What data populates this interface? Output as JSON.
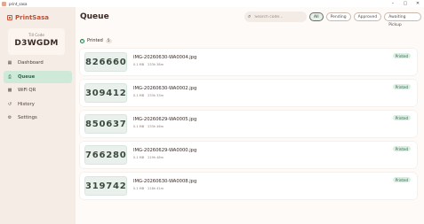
{
  "window": {
    "title": "print_sasa",
    "controls": [
      "–",
      "▢",
      "✕"
    ]
  },
  "sidebar": {
    "brand": "PrintSasa",
    "till_label": "Till Code",
    "till_code": "D3WGDM",
    "items": [
      {
        "label": "Dashboard",
        "icon": "dashboard-icon",
        "glyph": "▦",
        "active": false
      },
      {
        "label": "Queue",
        "icon": "printer-icon",
        "glyph": "⎙",
        "active": true
      },
      {
        "label": "WiFi QR",
        "icon": "qr-icon",
        "glyph": "▩",
        "active": false
      },
      {
        "label": "History",
        "icon": "history-icon",
        "glyph": "↺",
        "active": false
      },
      {
        "label": "Settings",
        "icon": "gear-icon",
        "glyph": "⚙",
        "active": false
      }
    ]
  },
  "main": {
    "title": "Queue",
    "search": {
      "placeholder": "Search code..."
    },
    "filters": [
      "All",
      "Pending",
      "Approved",
      "Awaiting Pickup"
    ],
    "section": {
      "label": "Printed",
      "count": "5"
    },
    "jobs": [
      {
        "code": "826660",
        "file": "IMG-20260630-WA0004.jpg",
        "size": "0.1 MB",
        "age": "233h 38m",
        "status": "Printed"
      },
      {
        "code": "309412",
        "file": "IMG-20260630-WA0002.jpg",
        "size": "0.1 MB",
        "age": "233h 33m",
        "status": "Printed"
      },
      {
        "code": "850637",
        "file": "IMG-20260629-WA0005.jpg",
        "size": "0.1 MB",
        "age": "233h 46m",
        "status": "Printed"
      },
      {
        "code": "766280",
        "file": "IMG-20260629-WA0000.jpg",
        "size": "0.1 MB",
        "age": "219h 48m",
        "status": "Printed"
      },
      {
        "code": "319742",
        "file": "IMG-20260630-WA0008.jpg",
        "size": "0.1 MB",
        "age": "218h 41m",
        "status": "Printed"
      }
    ]
  }
}
